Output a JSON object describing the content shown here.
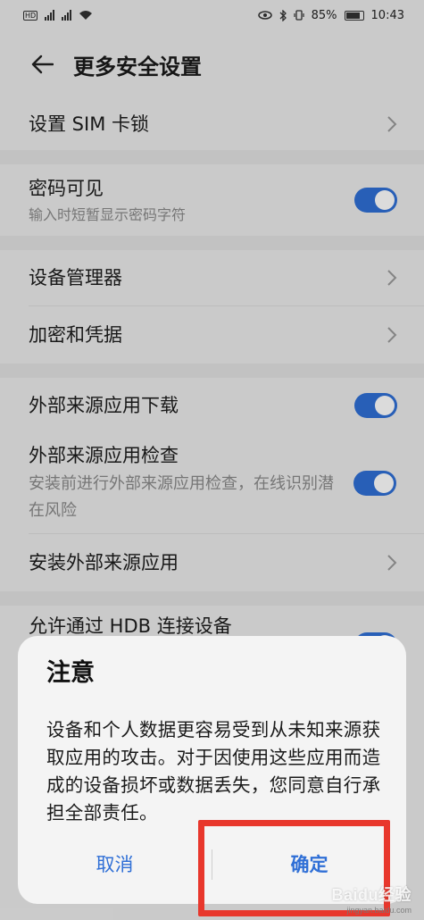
{
  "status_bar": {
    "left_tag_1": "HD",
    "left_tag_2": "4G",
    "battery": "85%",
    "time": "10:43"
  },
  "header": {
    "title": "更多安全设置"
  },
  "settings": {
    "sim_lock": {
      "title": "设置 SIM 卡锁"
    },
    "password_visible": {
      "title": "密码可见",
      "subtitle": "输入时短暂显示密码字符",
      "enabled": true
    },
    "device_admin": {
      "title": "设备管理器"
    },
    "encryption": {
      "title": "加密和凭据"
    },
    "external_download": {
      "title": "外部来源应用下载",
      "enabled": true
    },
    "external_check": {
      "title": "外部来源应用检查",
      "subtitle": "安装前进行外部来源应用检查，在线识别潜在风险",
      "enabled": true
    },
    "install_external": {
      "title": "安装外部来源应用"
    },
    "hdb": {
      "title": "允许通过 HDB 连接设备",
      "enabled": true
    }
  },
  "dialog": {
    "title": "注意",
    "body": "设备和个人数据更容易受到从未知来源获取应用的攻击。对于因使用这些应用而造成的设备损坏或数据丢失，您同意自行承担全部责任。",
    "cancel_label": "取消",
    "confirm_label": "确定"
  },
  "watermark": {
    "logo": "Baidu经验",
    "url": "jingyan.baidu.com"
  },
  "colors": {
    "accent": "#2f6fd6",
    "highlight": "#e8372c",
    "background": "#ececec"
  }
}
